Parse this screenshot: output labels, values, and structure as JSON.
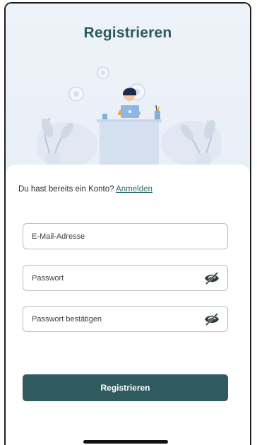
{
  "header": {
    "title": "Registrieren"
  },
  "login_prompt": {
    "text": "Du hast bereits ein Konto? ",
    "link_label": "Anmelden"
  },
  "form": {
    "email_placeholder": "E-Mail-Adresse",
    "password_placeholder": "Passwort",
    "confirm_placeholder": "Passwort bestätigen",
    "submit_label": "Registrieren"
  },
  "icons": {
    "password_toggle": "eye-slash-icon",
    "confirm_toggle": "eye-slash-icon"
  },
  "colors": {
    "brand": "#2b5a5e",
    "button": "#2f5b60",
    "hero_bg": "#eef3f9"
  }
}
